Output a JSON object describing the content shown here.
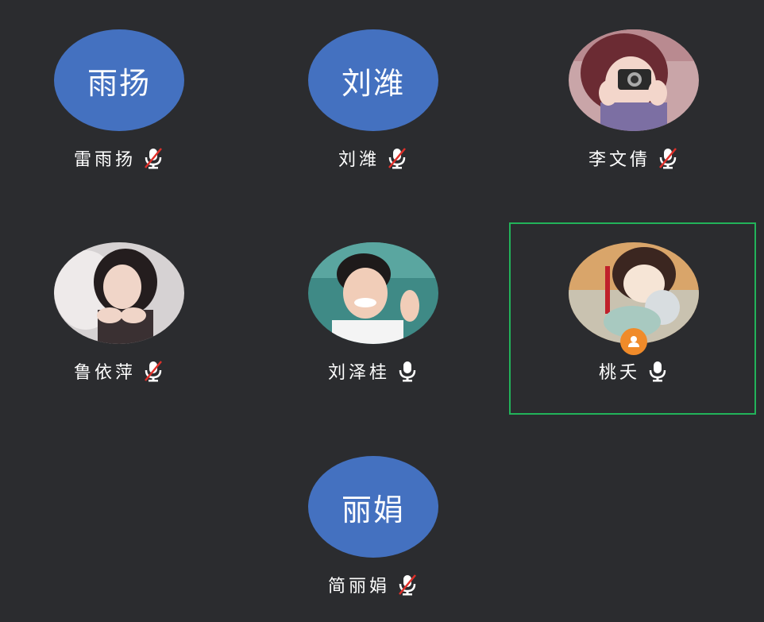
{
  "participants": [
    {
      "name": "雷雨扬",
      "avatar_text": "雨扬",
      "avatar_type": "text",
      "mic": "muted"
    },
    {
      "name": "刘潍",
      "avatar_text": "刘潍",
      "avatar_type": "text",
      "mic": "muted"
    },
    {
      "name": "李文倩",
      "avatar_type": "photo",
      "mic": "muted"
    },
    {
      "name": "鲁依萍",
      "avatar_type": "photo",
      "mic": "muted"
    },
    {
      "name": "刘泽桂",
      "avatar_type": "photo",
      "mic": "on"
    },
    {
      "name": "桃夭",
      "avatar_type": "photo",
      "mic": "on",
      "host": true,
      "active": true
    },
    {
      "name": "简丽娟",
      "avatar_text": "丽娟",
      "avatar_type": "text",
      "mic": "muted"
    }
  ],
  "colors": {
    "background": "#2b2c2f",
    "text_avatar": "#4471c0",
    "active_border": "#22b35a",
    "host_badge": "#f08b2a",
    "mute_slash": "#e0302a"
  }
}
